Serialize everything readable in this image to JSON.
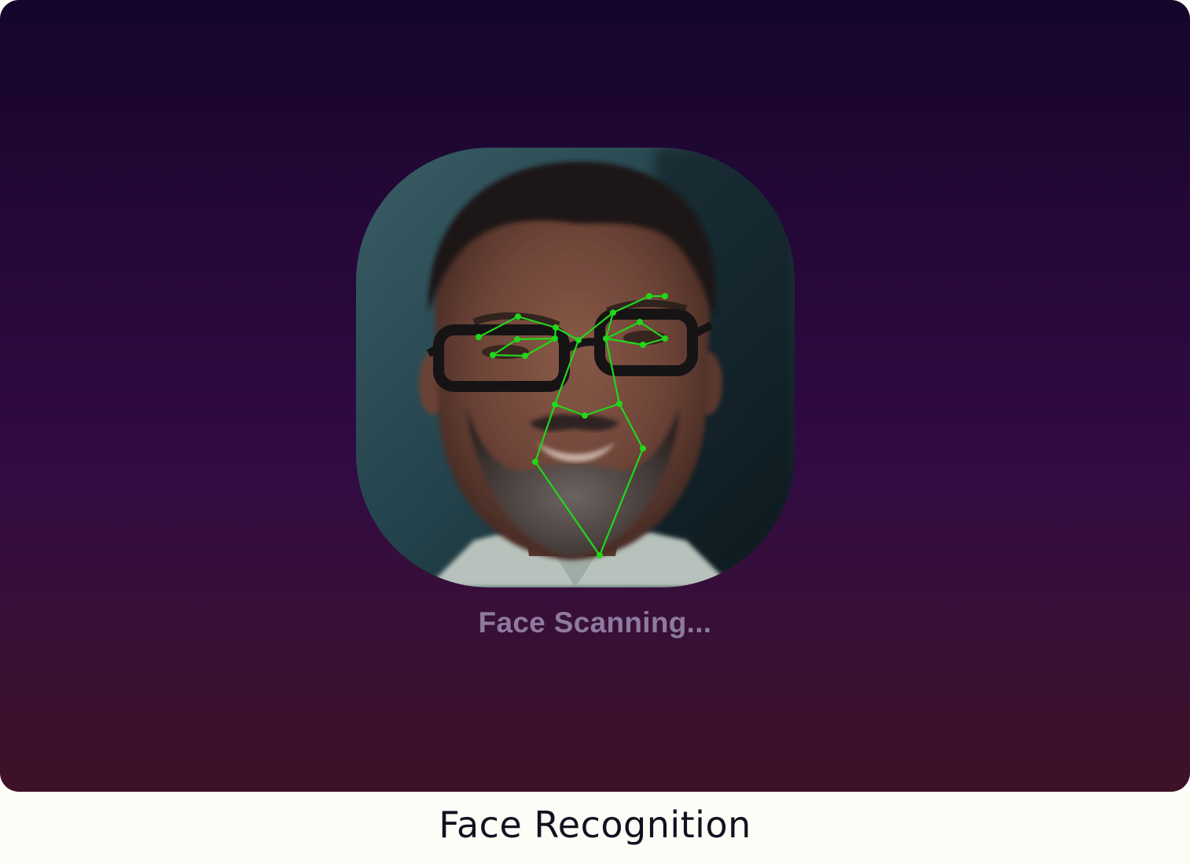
{
  "scanner": {
    "status_text": "Face Scanning...",
    "subject_image": "portrait of a bearded man wearing dark-rimmed glasses",
    "landmark_color": "#22d61a",
    "background_top_color": "#15052b",
    "background_bottom_color": "#3d1128"
  },
  "caption": {
    "title": "Face Recognition"
  }
}
